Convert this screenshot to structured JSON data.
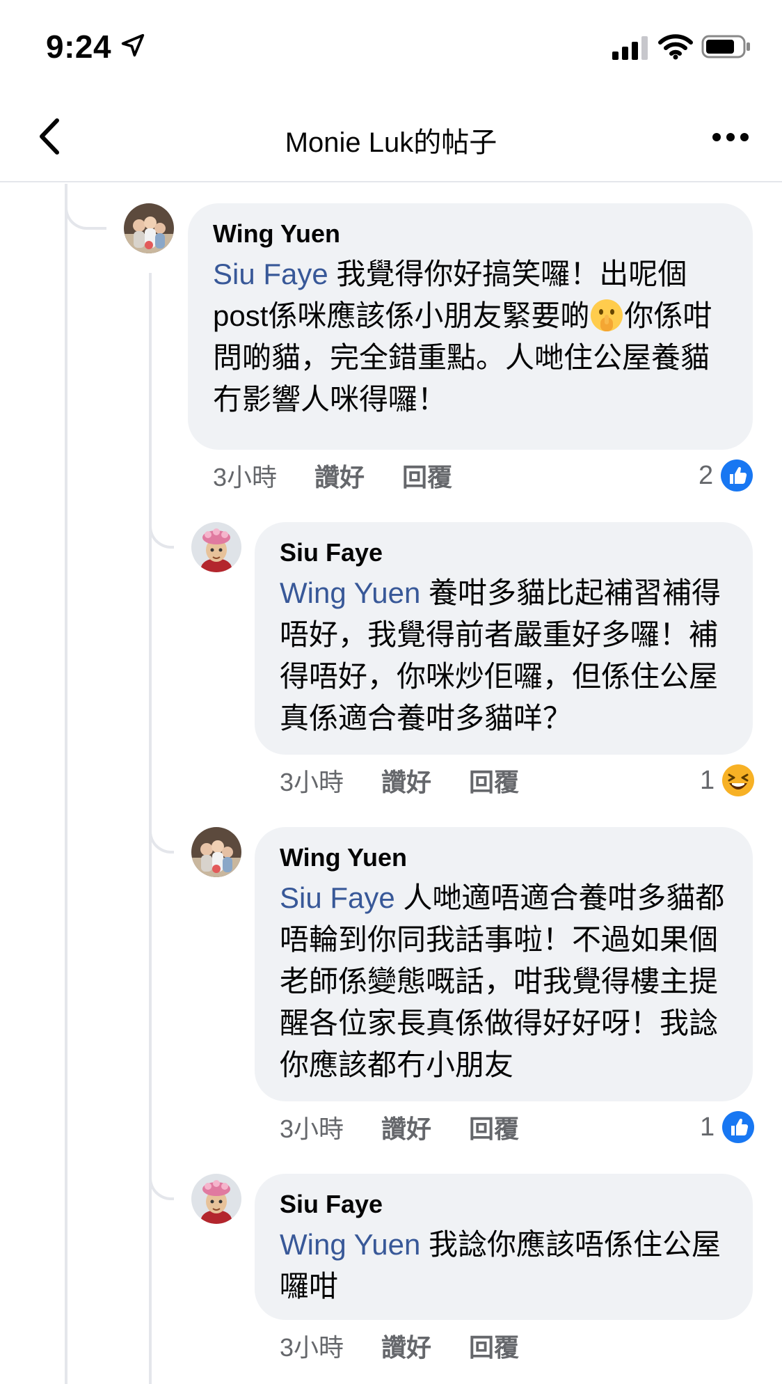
{
  "status_bar": {
    "time": "9:24",
    "icons": [
      "location-arrow-icon",
      "signal-icon",
      "wifi-icon",
      "battery-icon"
    ]
  },
  "header": {
    "title": "Monie Luk的帖子",
    "back_icon": "chevron-left-icon",
    "more_icon": "more-horizontal-icon"
  },
  "colors": {
    "mention": "#385898",
    "like_blue": "#1877f2",
    "bubble": "#f0f2f5",
    "meta": "#65676b"
  },
  "comments": [
    {
      "author": "Wing Yuen",
      "mention": "Siu Faye",
      "text_before_emoji": " 我覺得你好搞笑囉！出呢個post係咪應該係小朋友緊要啲",
      "emoji": "shushing-face",
      "text_after_emoji": "你係咁問啲貓，完全錯重點。人哋住公屋養貓冇影響人咪得囉！",
      "time": "3小時",
      "like": "讚好",
      "reply": "回覆",
      "reaction_count": "2",
      "reaction_icon": "like-icon"
    },
    {
      "author": "Siu Faye",
      "mention": "Wing Yuen",
      "text": " 養咁多貓比起補習補得唔好，我覺得前者嚴重好多囉！補得唔好，你咪炒佢囉，但係住公屋真係適合養咁多貓咩？",
      "time": "3小時",
      "like": "讚好",
      "reply": "回覆",
      "reaction_count": "1",
      "reaction_icon": "haha-icon"
    },
    {
      "author": "Wing Yuen",
      "mention": "Siu Faye",
      "text": " 人哋適唔適合養咁多貓都唔輪到你同我話事啦！不過如果個老師係變態嘅話，咁我覺得樓主提醒各位家長真係做得好好呀！我諗你應該都冇小朋友",
      "time": "3小時",
      "like": "讚好",
      "reply": "回覆",
      "reaction_count": "1",
      "reaction_icon": "like-icon"
    },
    {
      "author": "Siu Faye",
      "mention": "Wing Yuen",
      "text": " 我諗你應該唔係住公屋囉咁",
      "time": "3小時",
      "like": "讚好",
      "reply": "回覆"
    }
  ]
}
